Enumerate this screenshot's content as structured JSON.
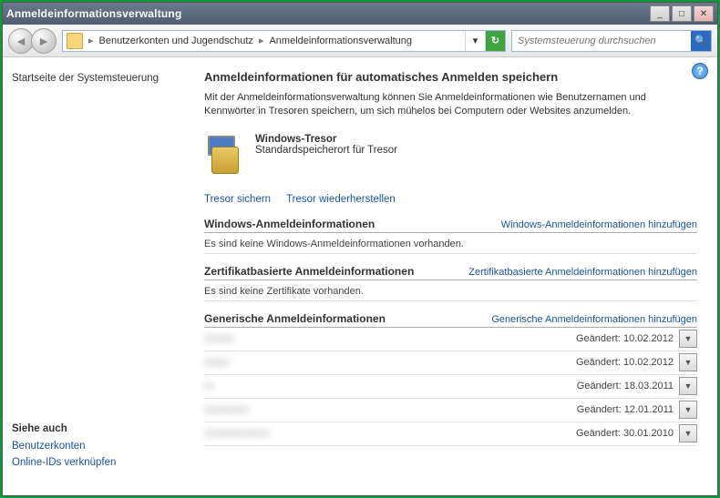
{
  "title": "Anmeldeinformationsverwaltung",
  "breadcrumb": {
    "level1": "Benutzerkonten und Jugendschutz",
    "level2": "Anmeldeinformationsverwaltung"
  },
  "search": {
    "placeholder": "Systemsteuerung durchsuchen"
  },
  "sidebar": {
    "home": "Startseite der Systemsteuerung",
    "seealso_heading": "Siehe auch",
    "links": [
      "Benutzerkonten",
      "Online-IDs verknüpfen"
    ]
  },
  "main": {
    "heading": "Anmeldeinformationen für automatisches Anmelden speichern",
    "description": "Mit der Anmeldeinformationsverwaltung können Sie Anmeldeinformationen wie Benutzernamen und Kennwörter in Tresoren speichern, um sich mühelos bei Computern oder Websites anzumelden.",
    "vault": {
      "title": "Windows-Tresor",
      "subtitle": "Standardspeicherort für Tresor"
    },
    "actions": {
      "backup": "Tresor sichern",
      "restore": "Tresor wiederherstellen"
    },
    "sections": [
      {
        "title": "Windows-Anmeldeinformationen",
        "add": "Windows-Anmeldeinformationen hinzufügen",
        "empty": "Es sind keine Windows-Anmeldeinformationen vorhanden."
      },
      {
        "title": "Zertifikatbasierte Anmeldeinformationen",
        "add": "Zertifikatbasierte Anmeldeinformationen hinzufügen",
        "empty": "Es sind keine Zertifikate vorhanden."
      },
      {
        "title": "Generische Anmeldeinformationen",
        "add": "Generische Anmeldeinformationen hinzufügen",
        "items": [
          {
            "site": "xxxxxx",
            "date": "Geändert: 10.02.2012"
          },
          {
            "site": "xxxxx",
            "date": "Geändert: 10.02.2012"
          },
          {
            "site": "xx",
            "date": "Geändert: 18.03.2011"
          },
          {
            "site": "xxxxxxxxx",
            "date": "Geändert: 12.01.2011"
          },
          {
            "site": "xxxxxxxxxxxxx",
            "date": "Geändert: 30.01.2010"
          }
        ]
      }
    ]
  }
}
